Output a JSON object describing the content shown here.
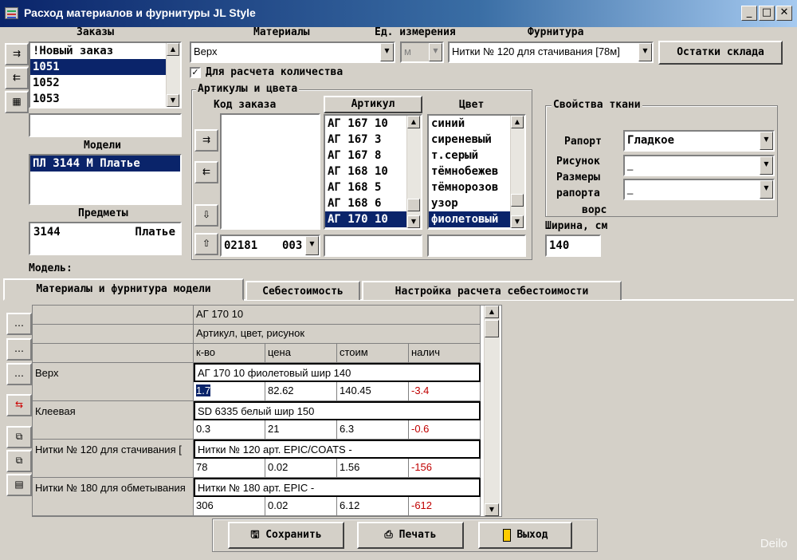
{
  "window": {
    "title": "Расход материалов и фурнитуры JL Style"
  },
  "orders": {
    "label": "Заказы",
    "items": [
      "!Новый заказ",
      "1051",
      "1052",
      "1053"
    ],
    "selected_index": 1,
    "input_value": ""
  },
  "models": {
    "label": "Модели",
    "items": [
      "ПЛ 3144 М Платье"
    ]
  },
  "subjects": {
    "label": "Предметы",
    "code": "3144",
    "name": "Платье"
  },
  "materials": {
    "label": "Материалы",
    "value": "Верх"
  },
  "units": {
    "label": "Ед. измерения",
    "value": "м"
  },
  "hardware": {
    "label": "Фурнитура",
    "value": "Нитки № 120 для стачивания [78м]"
  },
  "stock_button": "Остатки склада",
  "qty_checkbox": {
    "label": "Для расчета количества",
    "checked": true
  },
  "articles": {
    "group_label": "Артикулы и цвета",
    "order_code_label": "Код заказа",
    "order_code_value": "02181",
    "order_code_suffix": "003",
    "article_label": "Артикул",
    "article_items": [
      "АГ 167 10",
      "АГ 167 3",
      "АГ 167 8",
      "АГ 168 10",
      "АГ 168 5",
      "АГ 168 6",
      "АГ 170 10"
    ],
    "color_label": "Цвет",
    "color_items": [
      "синий",
      "сиреневый",
      "т.серый",
      "тёмнобежев",
      "тёмнорозов",
      "узор",
      "фиолетовый"
    ]
  },
  "fabric": {
    "group_label": "Свойства ткани",
    "rapport_label": "Рапорт",
    "rapport_value": "Гладкое",
    "pattern_label": "Рисунок",
    "pattern_value": "_",
    "sizes_label_1": "Размеры",
    "sizes_label_2": "рапорта",
    "sizes_label_3": "ворс",
    "sizes_value": "_",
    "width_label": "Ширина, см",
    "width_value": "140"
  },
  "model_label": "Модель:",
  "tabs": [
    "Материалы и фурнитура модели",
    "Себестоимость",
    "Настройка расчета себестоимости"
  ],
  "grid": {
    "header1": "АГ 170 10",
    "header2": "Артикул, цвет, рисунок",
    "columns": [
      "к-во",
      "цена",
      "стоим",
      "налич"
    ],
    "rows": [
      {
        "name": "Верх",
        "desc": "АГ 170 10 фиолетовый  шир 140",
        "qty": "1.7",
        "price": "82.62",
        "cost": "140.45",
        "avail": "-3.4"
      },
      {
        "name": "Клеевая",
        "desc": "SD 6335 белый  шир 150",
        "qty": "0.3",
        "price": "21",
        "cost": "6.3",
        "avail": "-0.6"
      },
      {
        "name": "Нитки № 120 для стачивания [",
        "desc": "Нитки № 120 арт. EPIC/COATS -",
        "qty": "78",
        "price": "0.02",
        "cost": "1.56",
        "avail": "-156"
      },
      {
        "name": "Нитки № 180 для обметывания",
        "desc": "Нитки № 180 арт. EPIC -",
        "qty": "306",
        "price": "0.02",
        "cost": "6.12",
        "avail": "-612"
      }
    ]
  },
  "buttons": {
    "save": "Сохранить",
    "print": "Печать",
    "exit": "Выход"
  },
  "watermark": "Deilo"
}
